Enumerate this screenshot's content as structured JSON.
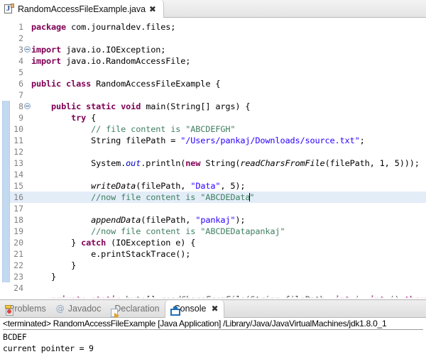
{
  "editor": {
    "tab": {
      "icon": "java-file-icon",
      "label": "RandomAccessFileExample.java",
      "close_glyph": "✖"
    },
    "highlighted_line": 16,
    "lines": [
      {
        "n": 1,
        "fold": false,
        "segments": [
          {
            "t": "package ",
            "c": "kw"
          },
          {
            "t": "com.journaldev.files;",
            "c": ""
          }
        ]
      },
      {
        "n": 2,
        "fold": false,
        "segments": []
      },
      {
        "n": 3,
        "fold": true,
        "segments": [
          {
            "t": "import ",
            "c": "kw"
          },
          {
            "t": "java.io.IOException;",
            "c": ""
          }
        ]
      },
      {
        "n": 4,
        "fold": false,
        "segments": [
          {
            "t": "import ",
            "c": "kw"
          },
          {
            "t": "java.io.RandomAccessFile;",
            "c": ""
          }
        ]
      },
      {
        "n": 5,
        "fold": false,
        "segments": []
      },
      {
        "n": 6,
        "fold": false,
        "segments": [
          {
            "t": "public class ",
            "c": "kw"
          },
          {
            "t": "RandomAccessFileExample {",
            "c": ""
          }
        ]
      },
      {
        "n": 7,
        "fold": false,
        "segments": []
      },
      {
        "n": 8,
        "fold": true,
        "segments": [
          {
            "t": "    ",
            "c": ""
          },
          {
            "t": "public static void ",
            "c": "kw"
          },
          {
            "t": "main(String[] args) {",
            "c": ""
          }
        ]
      },
      {
        "n": 9,
        "fold": false,
        "segments": [
          {
            "t": "        ",
            "c": ""
          },
          {
            "t": "try",
            "c": "kw"
          },
          {
            "t": " {",
            "c": ""
          }
        ]
      },
      {
        "n": 10,
        "fold": false,
        "segments": [
          {
            "t": "            ",
            "c": ""
          },
          {
            "t": "// file content is \"ABCDEFGH\"",
            "c": "cmt"
          }
        ]
      },
      {
        "n": 11,
        "fold": false,
        "segments": [
          {
            "t": "            String filePath = ",
            "c": ""
          },
          {
            "t": "\"/Users/pankaj/Downloads/source.txt\"",
            "c": "str"
          },
          {
            "t": ";",
            "c": ""
          }
        ]
      },
      {
        "n": 12,
        "fold": false,
        "segments": []
      },
      {
        "n": 13,
        "fold": false,
        "segments": [
          {
            "t": "            System.",
            "c": ""
          },
          {
            "t": "out",
            "c": "fld"
          },
          {
            "t": ".println(",
            "c": ""
          },
          {
            "t": "new ",
            "c": "kw"
          },
          {
            "t": "String(",
            "c": ""
          },
          {
            "t": "readCharsFromFile",
            "c": "mth"
          },
          {
            "t": "(filePath, 1, 5)));",
            "c": ""
          }
        ]
      },
      {
        "n": 14,
        "fold": false,
        "segments": []
      },
      {
        "n": 15,
        "fold": false,
        "segments": [
          {
            "t": "            ",
            "c": ""
          },
          {
            "t": "writeData",
            "c": "mth"
          },
          {
            "t": "(filePath, ",
            "c": ""
          },
          {
            "t": "\"Data\"",
            "c": "str"
          },
          {
            "t": ", 5);",
            "c": ""
          }
        ]
      },
      {
        "n": 16,
        "fold": false,
        "segments": [
          {
            "t": "            ",
            "c": ""
          },
          {
            "t": "//now file content is \"ABCDEData",
            "c": "cmt"
          },
          {
            "t": "CARET",
            "c": "caret"
          },
          {
            "t": "\"",
            "c": "cmt"
          }
        ]
      },
      {
        "n": 17,
        "fold": false,
        "segments": []
      },
      {
        "n": 18,
        "fold": false,
        "segments": [
          {
            "t": "            ",
            "c": ""
          },
          {
            "t": "appendData",
            "c": "mth"
          },
          {
            "t": "(filePath, ",
            "c": ""
          },
          {
            "t": "\"pankaj\"",
            "c": "str"
          },
          {
            "t": ");",
            "c": ""
          }
        ]
      },
      {
        "n": 19,
        "fold": false,
        "segments": [
          {
            "t": "            ",
            "c": ""
          },
          {
            "t": "//now file content is \"ABCDEDatapankaj\"",
            "c": "cmt"
          }
        ]
      },
      {
        "n": 20,
        "fold": false,
        "segments": [
          {
            "t": "        } ",
            "c": ""
          },
          {
            "t": "catch ",
            "c": "kw"
          },
          {
            "t": "(IOException e) {",
            "c": ""
          }
        ]
      },
      {
        "n": 21,
        "fold": false,
        "segments": [
          {
            "t": "            e.printStackTrace();",
            "c": ""
          }
        ]
      },
      {
        "n": 22,
        "fold": false,
        "segments": [
          {
            "t": "        }",
            "c": ""
          }
        ]
      },
      {
        "n": 23,
        "fold": false,
        "segments": [
          {
            "t": "    }",
            "c": ""
          }
        ]
      },
      {
        "n": 24,
        "fold": false,
        "segments": []
      }
    ]
  },
  "bottom_panel": {
    "tabs": [
      {
        "id": "problems",
        "icon": "problems-icon",
        "label": "Problems",
        "active": false
      },
      {
        "id": "javadoc",
        "icon": "javadoc-at-icon",
        "label": "Javadoc",
        "active": false
      },
      {
        "id": "declaration",
        "icon": "declaration-icon",
        "label": "Declaration",
        "active": false
      },
      {
        "id": "console",
        "icon": "console-icon",
        "label": "Console",
        "active": true
      }
    ],
    "console": {
      "header": "<terminated> RandomAccessFileExample [Java Application] /Library/Java/JavaVirtualMachines/jdk1.8.0_1",
      "output": [
        "BCDEF",
        "current pointer = 9"
      ]
    }
  },
  "colors": {
    "keyword": "#7f0055",
    "string": "#2a00ff",
    "comment": "#3f7f5f",
    "static_field": "#0000c0",
    "line_highlight": "#e3edf8",
    "changebar": "#c3d9f0"
  }
}
